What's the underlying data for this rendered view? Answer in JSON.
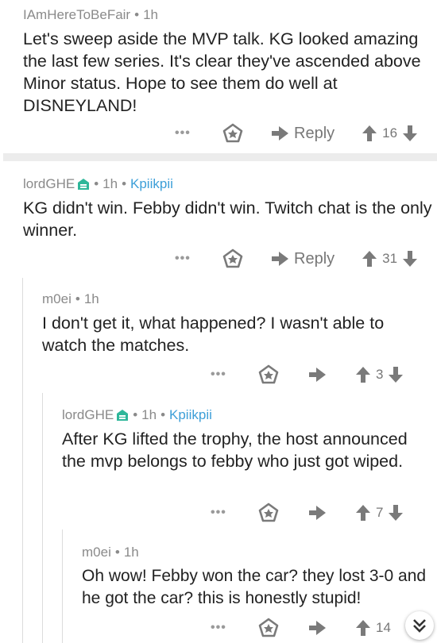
{
  "comments": [
    {
      "author": "IAmHereToBeFair",
      "time": "1h",
      "flair": "",
      "body": "Let's sweep aside the MVP talk. KG looked amazing the last few series. It's clear they've ascended above Minor status. Hope to see them do well at DISNEYLAND!",
      "more": "•••",
      "reply": "Reply",
      "score": "16"
    },
    {
      "author": "lordGHE",
      "time": "1h",
      "flair": "Kpiikpii",
      "body": "KG didn't win. Febby didn't win. Twitch chat is the only winner.",
      "more": "•••",
      "reply": "Reply",
      "score": "31"
    },
    {
      "author": "m0ei",
      "time": "1h",
      "flair": "",
      "body": "I don't get it, what happened? I wasn't able to watch the matches.",
      "more": "•••",
      "reply": "",
      "score": "3"
    },
    {
      "author": "lordGHE",
      "time": "1h",
      "flair": "Kpiikpii",
      "body": "After KG lifted the trophy, the host announced the mvp belongs to febby who just got wiped.",
      "more": "•••",
      "reply": "",
      "score": "7"
    },
    {
      "author": "m0ei",
      "time": "1h",
      "flair": "",
      "body": "Oh wow! Febby won the car? they lost 3-0 and he got the car? this is honestly stupid!",
      "more": "•••",
      "reply": "",
      "score": "14"
    }
  ],
  "icons": {
    "gild": "gild-icon",
    "reply": "reply-arrow-icon",
    "upvote": "upvote-icon",
    "downvote": "downvote-icon",
    "mod": "mod-shield-icon",
    "collapse": "collapse-chevrons-icon"
  },
  "colors": {
    "flair": "#3d9fd8",
    "mod": "#2fb79a",
    "meta": "#8a8a8a"
  }
}
